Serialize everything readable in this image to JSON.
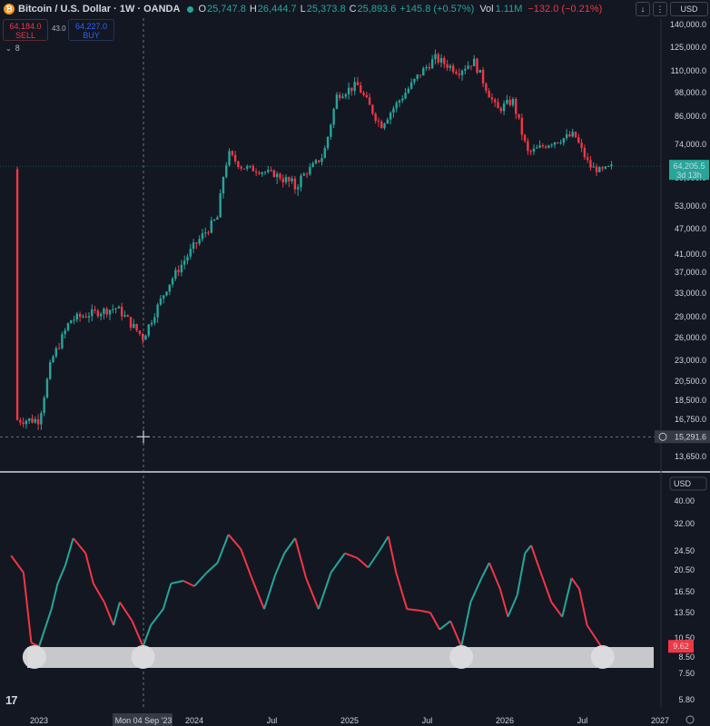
{
  "header": {
    "logo": "₿",
    "title": "Bitcoin / U.S. Dollar · 1W · OANDA",
    "ohlc": [
      {
        "k": "O",
        "v": "25,747.8"
      },
      {
        "k": "H",
        "v": "26,444.7"
      },
      {
        "k": "L",
        "v": "25,373.8"
      },
      {
        "k": "C",
        "v": "25,893.6"
      }
    ],
    "change": "+145.8 (+0.57%)",
    "vol_label": "Vol",
    "vol_value": "1.11M",
    "vol_change": "−132.0 (−0.21%)",
    "currency": "USD",
    "download": "↓",
    "menu": "⋮"
  },
  "trade": {
    "sell_price": "64,184.0",
    "sell_label": "SELL",
    "spread": "43.0",
    "buy_price": "64,227.0",
    "buy_label": "BUY",
    "indicator_count": "8",
    "arrow": "⌄"
  },
  "tv_logo": "17",
  "chart_data": [
    {
      "type": "candlestick",
      "price_labels": [
        "140,000.0",
        "125,000.0",
        "110,000.0",
        "98,000.0",
        "86,000.0",
        "74,000.0",
        "59,000.0",
        "53,000.0",
        "47,000.0",
        "41,000.0",
        "37,000.0",
        "33,000.0",
        "29,000.0",
        "26,000.0",
        "23,000.0",
        "20,500.0",
        "18,500.0",
        "16,750.0",
        "13,650.0"
      ],
      "last_price": "64,205.5",
      "countdown": "3d 13h",
      "crosshair_price": "15,291.6",
      "close_path": [
        [
          2023.0,
          16700
        ],
        [
          2023.08,
          23000
        ],
        [
          2023.2,
          28500
        ],
        [
          2023.33,
          29500
        ],
        [
          2023.5,
          30500
        ],
        [
          2023.67,
          26000
        ],
        [
          2023.83,
          34500
        ],
        [
          2024.0,
          43000
        ],
        [
          2024.15,
          50000
        ],
        [
          2024.22,
          70000
        ],
        [
          2024.3,
          64000
        ],
        [
          2024.5,
          61000
        ],
        [
          2024.65,
          57000
        ],
        [
          2024.83,
          69000
        ],
        [
          2024.92,
          97000
        ],
        [
          2025.05,
          102000
        ],
        [
          2025.2,
          82000
        ],
        [
          2025.33,
          95000
        ],
        [
          2025.45,
          108000
        ],
        [
          2025.55,
          118000
        ],
        [
          2025.7,
          110000
        ],
        [
          2025.8,
          116000
        ],
        [
          2025.95,
          89000
        ],
        [
          2026.05,
          94000
        ],
        [
          2026.15,
          70000
        ],
        [
          2026.3,
          75000
        ],
        [
          2026.45,
          78000
        ],
        [
          2026.55,
          64000
        ],
        [
          2026.62,
          62000
        ],
        [
          2026.7,
          64200
        ]
      ]
    },
    {
      "type": "line",
      "currency": "USD",
      "value_labels": [
        "40.00",
        "32.00",
        "24.50",
        "20.50",
        "16.50",
        "13.50",
        "10.50",
        "8.50",
        "7.50",
        "5.80"
      ],
      "last_value": "9.62",
      "x_ticks": [
        "2023",
        "2024",
        "Jul",
        "2025",
        "Jul",
        "2026",
        "Jul",
        "2027"
      ],
      "crosshair_date": "Mon 04 Sep '23",
      "path": [
        [
          2022.82,
          23.5
        ],
        [
          2022.9,
          20
        ],
        [
          2022.95,
          10
        ],
        [
          2023.0,
          9.6
        ],
        [
          2023.08,
          14
        ],
        [
          2023.12,
          18
        ],
        [
          2023.17,
          21.5
        ],
        [
          2023.22,
          28
        ],
        [
          2023.3,
          24
        ],
        [
          2023.35,
          18
        ],
        [
          2023.42,
          15
        ],
        [
          2023.48,
          12
        ],
        [
          2023.52,
          15
        ],
        [
          2023.6,
          12.5
        ],
        [
          2023.67,
          9.6
        ],
        [
          2023.72,
          12
        ],
        [
          2023.8,
          14
        ],
        [
          2023.85,
          18
        ],
        [
          2023.93,
          18.5
        ],
        [
          2024.0,
          17.5
        ],
        [
          2024.08,
          20
        ],
        [
          2024.15,
          22
        ],
        [
          2024.22,
          29
        ],
        [
          2024.3,
          25
        ],
        [
          2024.37,
          19
        ],
        [
          2024.45,
          14
        ],
        [
          2024.52,
          19.5
        ],
        [
          2024.58,
          24
        ],
        [
          2024.65,
          28
        ],
        [
          2024.72,
          19
        ],
        [
          2024.8,
          14
        ],
        [
          2024.88,
          20
        ],
        [
          2024.97,
          24
        ],
        [
          2025.05,
          23
        ],
        [
          2025.12,
          21
        ],
        [
          2025.2,
          25
        ],
        [
          2025.25,
          28.5
        ],
        [
          2025.3,
          20
        ],
        [
          2025.37,
          14
        ],
        [
          2025.45,
          13.8
        ],
        [
          2025.52,
          13.5
        ],
        [
          2025.58,
          11.5
        ],
        [
          2025.65,
          12.5
        ],
        [
          2025.72,
          9.6
        ],
        [
          2025.78,
          15
        ],
        [
          2025.85,
          19
        ],
        [
          2025.9,
          22
        ],
        [
          2025.97,
          17
        ],
        [
          2026.02,
          13
        ],
        [
          2026.08,
          16
        ],
        [
          2026.13,
          24
        ],
        [
          2026.17,
          26
        ],
        [
          2026.22,
          21
        ],
        [
          2026.3,
          15
        ],
        [
          2026.37,
          13
        ],
        [
          2026.43,
          19
        ],
        [
          2026.48,
          17
        ],
        [
          2026.53,
          12
        ],
        [
          2026.62,
          9.62
        ]
      ],
      "support_markers": [
        2022.97,
        2023.67,
        2025.72,
        2026.63
      ]
    }
  ]
}
